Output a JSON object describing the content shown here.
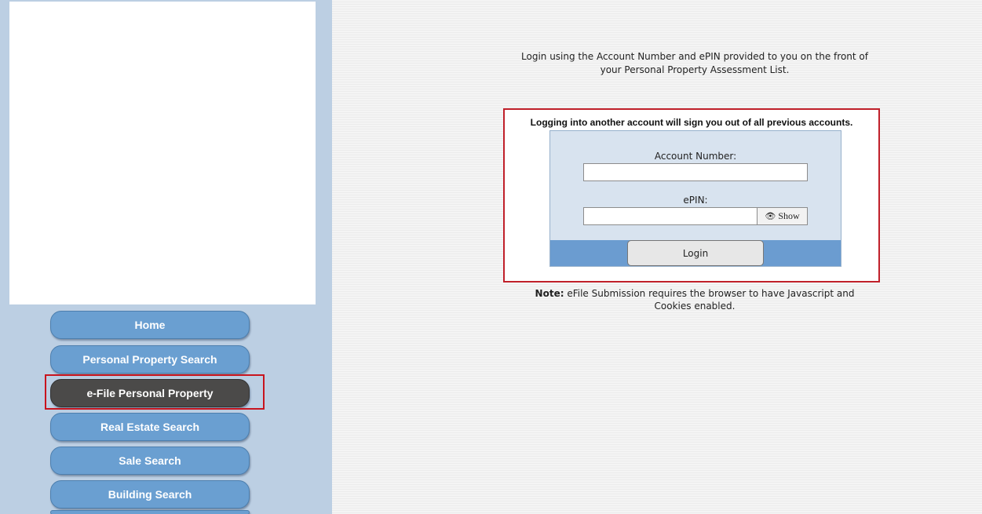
{
  "sidebar": {
    "items": [
      {
        "label": "Home",
        "active": false
      },
      {
        "label": "Personal Property Search",
        "active": false
      },
      {
        "label": "e-File Personal Property",
        "active": true
      },
      {
        "label": "Real Estate Search",
        "active": false
      },
      {
        "label": "Sale Search",
        "active": false
      },
      {
        "label": "Building Search",
        "active": false
      }
    ]
  },
  "main": {
    "intro_line1": "Login using the Account Number and ePIN provided to you on the front of",
    "intro_line2": "your Personal Property Assessment List.",
    "warning": "Logging into another account will sign you out of all previous accounts.",
    "account_label": "Account Number:",
    "account_value": "",
    "epin_label": "ePIN:",
    "epin_value": "",
    "show_label": "Show",
    "show_icon": "eye-icon",
    "login_label": "Login",
    "note_prefix": "Note:",
    "note_line1": "eFile Submission requires the browser to have Javascript and",
    "note_line2": "Cookies enabled."
  },
  "colors": {
    "sidebar_bg": "#bccfe3",
    "nav_button": "#6a9fd1",
    "nav_active": "#4b4a49",
    "highlight_border": "#c8141e",
    "panel_bg": "#d8e3ef",
    "button_bar": "#6b9cd0"
  }
}
